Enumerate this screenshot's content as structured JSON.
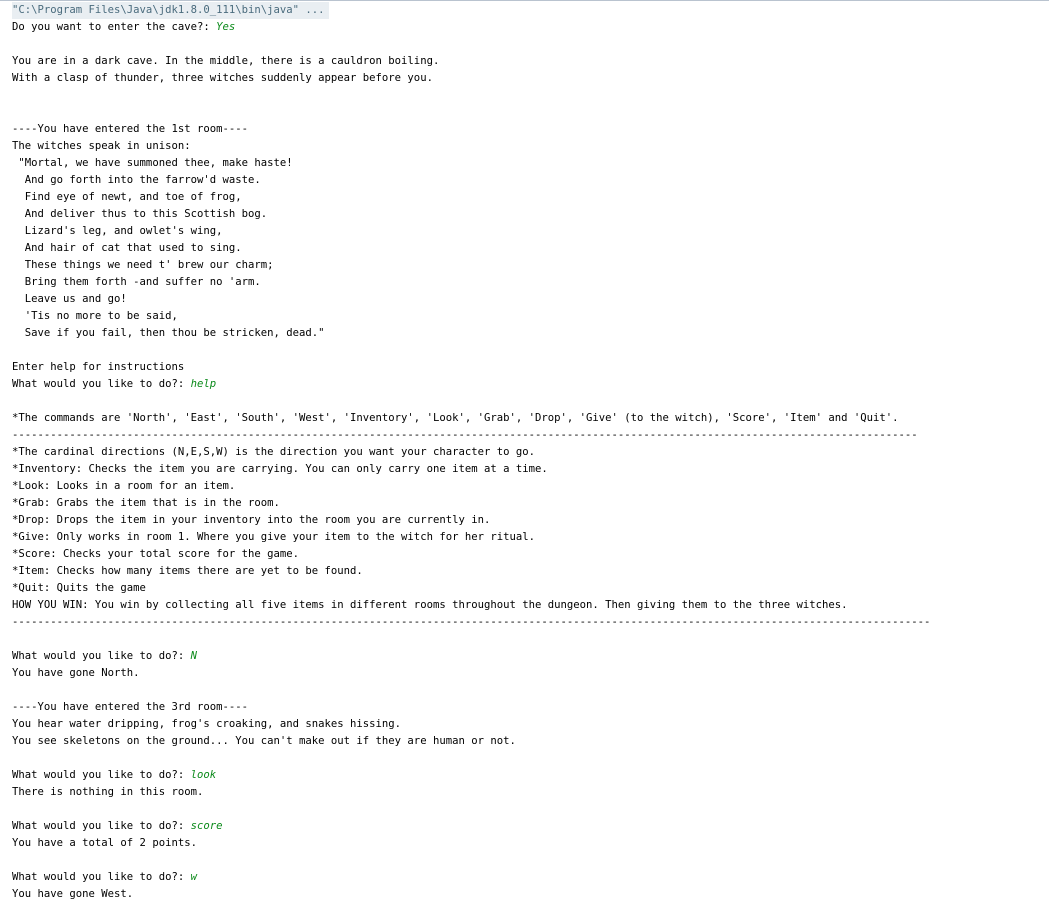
{
  "window": {
    "command_line": "\"C:\\Program Files\\Java\\jdk1.8.0_111\\bin\\java\" ..."
  },
  "colors": {
    "user_input": "#0b8a1a",
    "command_line_bg": "#e9eef2",
    "command_line_text": "#4a6b7d"
  },
  "console": {
    "enter_prompt": "Do you want to enter the cave?: ",
    "enter_answer": "Yes",
    "intro_1": "You are in a dark cave. In the middle, there is a cauldron boiling.",
    "intro_2": "With a clasp of thunder, three witches suddenly appear before you.",
    "room1_header": "----You have entered the 1st room----",
    "witches_speak": "The witches speak in unison:",
    "poem": [
      " \"Mortal, we have summoned thee, make haste!",
      "  And go forth into the farrow'd waste.",
      "  Find eye of newt, and toe of frog,",
      "  And deliver thus to this Scottish bog.",
      "  Lizard's leg, and owlet's wing,",
      "  And hair of cat that used to sing.",
      "  These things we need t' brew our charm;",
      "  Bring them forth -and suffer no 'arm.",
      "  Leave us and go!",
      "  'Tis no more to be said,",
      "  Save if you fail, then thou be stricken, dead.\""
    ],
    "help_hint": "Enter help for instructions",
    "prompt": "What would you like to do?: ",
    "input_help": "help",
    "commands_line": "*The commands are 'North', 'East', 'South', 'West', 'Inventory', 'Look', 'Grab', 'Drop', 'Give' (to the witch), 'Score', 'Item' and 'Quit'.",
    "divider_1": "----------------------------------------------------------------------------------------------------------------------------------------------",
    "help_lines": [
      "*The cardinal directions (N,E,S,W) is the direction you want your character to go.",
      "*Inventory: Checks the item you are carrying. You can only carry one item at a time.",
      "*Look: Looks in a room for an item.",
      "*Grab: Grabs the item that is in the room.",
      "*Drop: Drops the item in your inventory into the room you are currently in.",
      "*Give: Only works in room 1. Where you give your item to the witch for her ritual.",
      "*Score: Checks your total score for the game.",
      "*Item: Checks how many items there are yet to be found.",
      "*Quit: Quits the game",
      "HOW YOU WIN: You win by collecting all five items in different rooms throughout the dungeon. Then giving them to the three witches."
    ],
    "divider_2": "------------------------------------------------------------------------------------------------------------------------------------------------",
    "input_n": "N",
    "gone_north": "You have gone North.",
    "room3_header": "----You have entered the 3rd room----",
    "room3_desc_1": "You hear water dripping, frog's croaking, and snakes hissing.",
    "room3_desc_2": "You see skeletons on the ground... You can't make out if they are human or not.",
    "input_look": "look",
    "nothing_here": "There is nothing in this room.",
    "input_score": "score",
    "score_result": "You have a total of 2 points.",
    "input_w": "w",
    "gone_west": "You have gone West."
  }
}
